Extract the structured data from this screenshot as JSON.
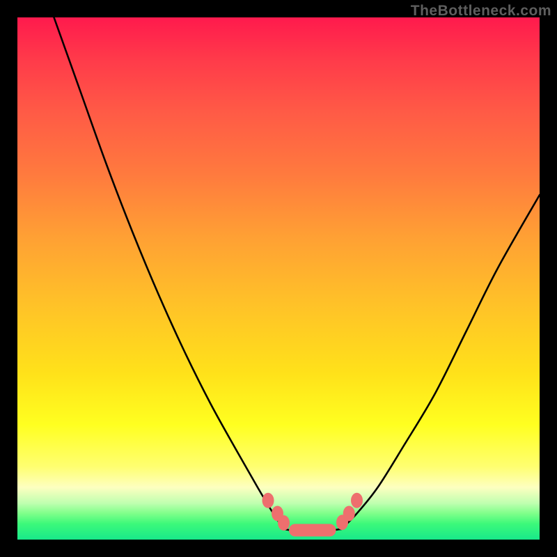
{
  "watermark": "TheBottleneck.com",
  "colors": {
    "frame": "#000000",
    "curve": "#000000",
    "marker": "#ee6f6e"
  },
  "chart_data": {
    "type": "line",
    "title": "",
    "xlabel": "",
    "ylabel": "",
    "xlim": [
      0,
      100
    ],
    "ylim": [
      0,
      100
    ],
    "grid": false,
    "series": [
      {
        "name": "left-curve",
        "x": [
          7,
          12,
          17,
          22,
          27,
          32,
          37,
          42,
          46,
          49,
          51
        ],
        "y": [
          100,
          86,
          72,
          59,
          47,
          36,
          26,
          17,
          10,
          5,
          2
        ]
      },
      {
        "name": "valley-floor",
        "x": [
          51,
          54,
          58,
          62
        ],
        "y": [
          2,
          1.6,
          1.6,
          2
        ]
      },
      {
        "name": "right-curve",
        "x": [
          62,
          65,
          69,
          74,
          80,
          86,
          92,
          100
        ],
        "y": [
          2,
          5,
          10,
          18,
          28,
          40,
          52,
          66
        ]
      }
    ],
    "markers": {
      "left_dots": [
        {
          "x": 48,
          "y": 7.5
        },
        {
          "x": 49.8,
          "y": 5
        },
        {
          "x": 51,
          "y": 3.2
        }
      ],
      "right_dots": [
        {
          "x": 62.2,
          "y": 3.3
        },
        {
          "x": 63.5,
          "y": 5
        },
        {
          "x": 65,
          "y": 7.5
        }
      ],
      "floor_pill": {
        "x1": 52,
        "x2": 61,
        "y": 1.8
      }
    }
  }
}
